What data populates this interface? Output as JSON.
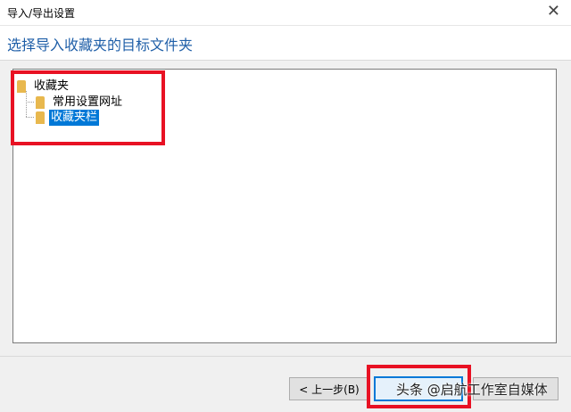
{
  "window": {
    "title": "导入/导出设置",
    "close_glyph": "✕"
  },
  "header": {
    "heading": "选择导入收藏夹的目标文件夹"
  },
  "tree": {
    "root": {
      "label": "收藏夹"
    },
    "children": [
      {
        "label": "常用设置网址",
        "selected": false
      },
      {
        "label": "收藏夹栏",
        "selected": true
      }
    ]
  },
  "buttons": {
    "back_label": "< 上一步(B)",
    "next_label": ""
  },
  "watermark": {
    "text": "头条 @启航工作室自媒体"
  },
  "colors": {
    "accent": "#1f5fa8",
    "selection": "#0078d7",
    "highlight": "#e81123",
    "folder": "#e8b84e"
  }
}
